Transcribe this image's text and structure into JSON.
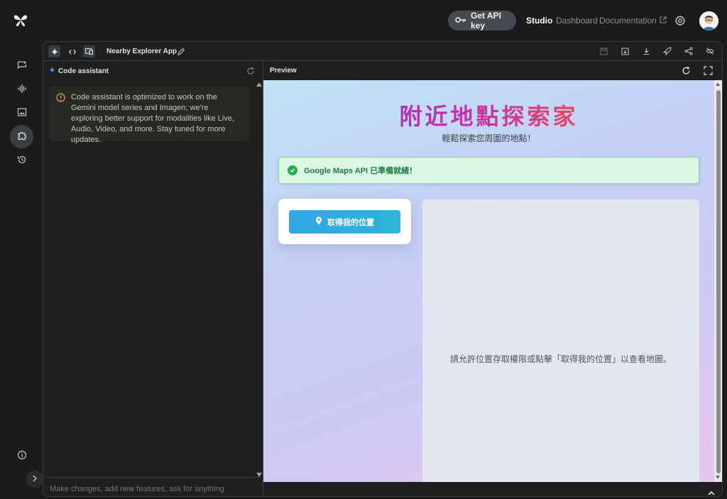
{
  "topbar": {
    "get_api_key": "Get API key",
    "studio": "Studio",
    "dashboard": "Dashboard",
    "documentation": "Documentation"
  },
  "toolbar": {
    "app_name": "Nearby Explorer App"
  },
  "assistant": {
    "title": "Code assistant",
    "notice": "Code assistant is optimized to work on the Gemini model series and Imagen; we're exploring better support for modalities like Live, Audio, Video, and more. Stay tuned for more updates.",
    "input_placeholder": "Make changes, add new features, ask for anything"
  },
  "preview": {
    "title": "Preview",
    "app": {
      "title": "附近地點探索家",
      "subtitle": "輕鬆探索您周圍的地點！",
      "status": "Google Maps API 已準備就緒！",
      "locate_button": "取得我的位置",
      "map_placeholder": "請允許位置存取權限或點擊「取得我的位置」以查看地圖。"
    }
  },
  "colors": {
    "accent_blue": "#36a4e6",
    "success_green": "#22b04b",
    "warning_orange": "#e8a44a"
  }
}
